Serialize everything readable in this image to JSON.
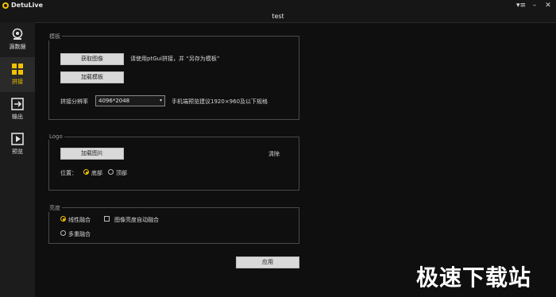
{
  "titlebar": {
    "app_name": "DetuLive"
  },
  "window_controls": {
    "menu_icon": "▾≡",
    "min_icon": "–",
    "close_icon": "✕"
  },
  "project": {
    "title": "test"
  },
  "sidebar": {
    "items": [
      {
        "label": "源数据",
        "icon": "camera-icon"
      },
      {
        "label": "拼接",
        "icon": "stitch-grid-icon"
      },
      {
        "label": "输出",
        "icon": "export-icon"
      },
      {
        "label": "预览",
        "icon": "play-icon"
      }
    ],
    "active_index": 1,
    "accent": "#f2c200"
  },
  "template_group": {
    "legend": "模板",
    "get_image_button": "获取图像",
    "hint": "请使用ptGui拼接，并 “另存为模板”",
    "load_template_button": "加载模板",
    "resolution_label": "拼接分辨率",
    "resolution_value": "4096*2048",
    "mobile_hint": "手机端预览建议1920×960及以下规格"
  },
  "logo_group": {
    "legend": "Logo",
    "load_image_button": "加载图片",
    "clear_button": "清除",
    "position_label": "位置：",
    "option_bottom": "底部",
    "option_top": "顶部"
  },
  "brightness_group": {
    "legend": "亮度",
    "option_linear": "线性融合",
    "option_auto": "图像亮度自动融合",
    "option_multi": "多重融合"
  },
  "apply_button": "应用",
  "watermark": "极速下载站"
}
